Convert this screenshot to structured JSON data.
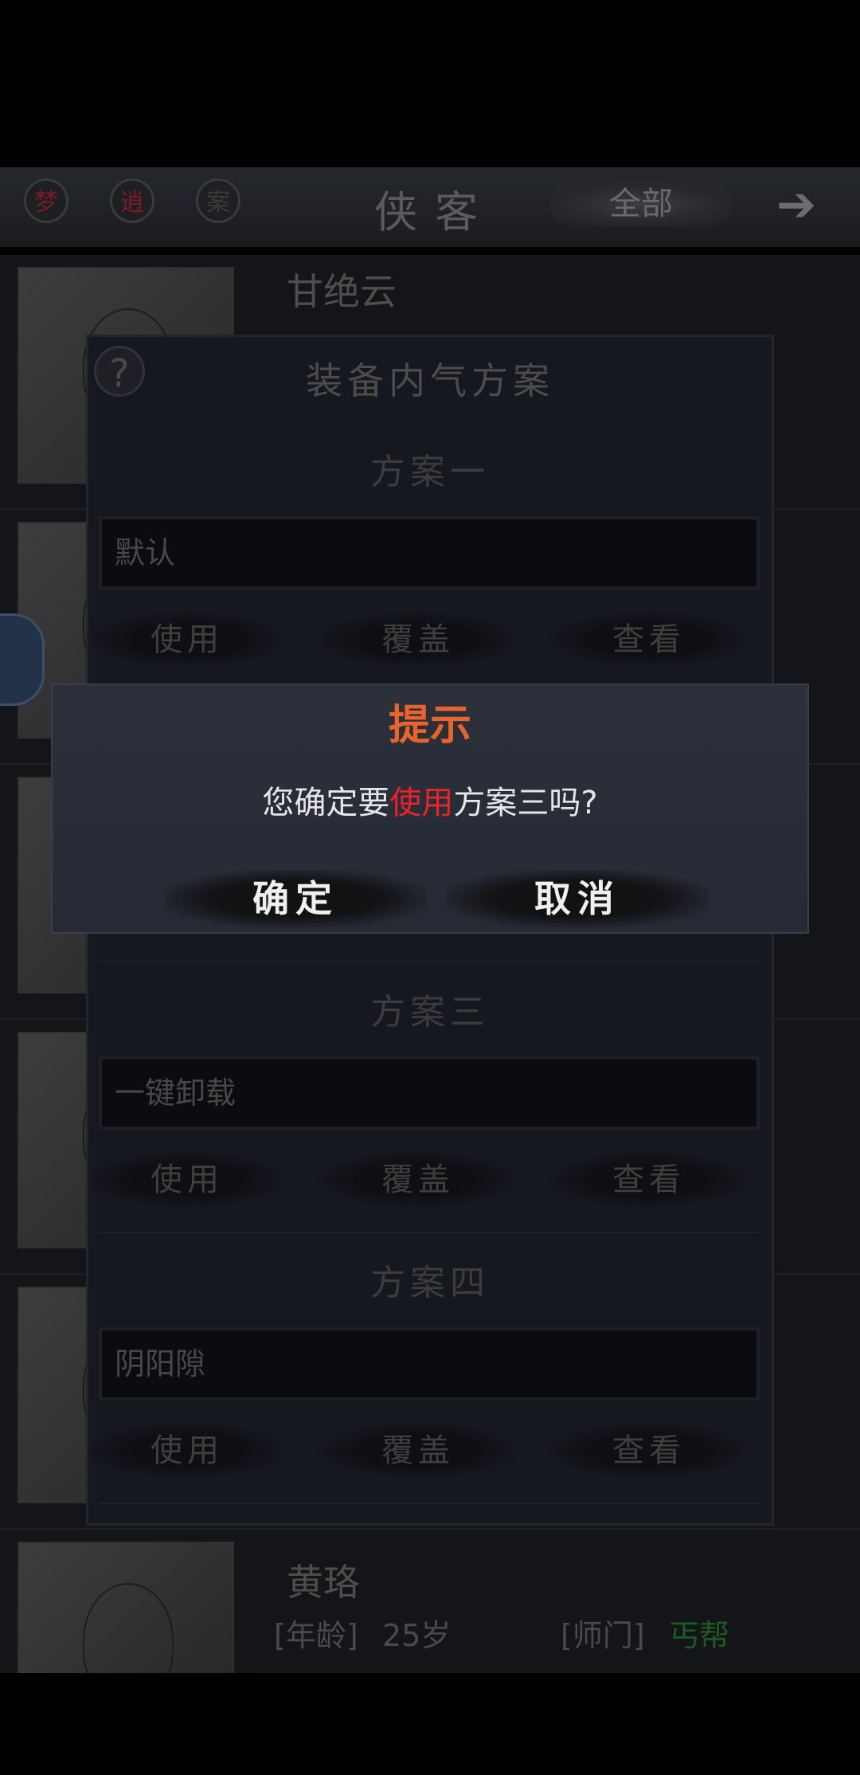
{
  "topbar": {
    "icons": [
      {
        "name": "sect-icon-1",
        "glyph": "梦"
      },
      {
        "name": "sect-icon-2",
        "glyph": "逍"
      },
      {
        "name": "sect-icon-3",
        "glyph": "案"
      }
    ],
    "title": "侠客",
    "filter": "全部",
    "next_icon": "right-arrow-icon"
  },
  "characters": [
    {
      "name": "甘绝云"
    },
    {
      "name": "黄珞"
    }
  ],
  "bottom_info": {
    "age_label": "[年龄]",
    "age_value": "25岁",
    "sect_label": "[师门]",
    "sect_value": "丐帮",
    "sect_color": "#2a7a32"
  },
  "plan_panel": {
    "help": "?",
    "title": "装备内气方案",
    "plans": [
      {
        "header": "方案一",
        "field": "默认",
        "use": "使用",
        "overwrite": "覆盖",
        "view": "查看"
      },
      {
        "header": "方案三",
        "field": "一键卸载",
        "use": "使用",
        "overwrite": "覆盖",
        "view": "查看"
      },
      {
        "header": "方案四",
        "field": "阴阳隙",
        "use": "使用",
        "overwrite": "覆盖",
        "view": "查看"
      }
    ]
  },
  "dialog": {
    "title": "提示",
    "msg_before": "您确定要",
    "msg_highlight": "使用",
    "msg_after": "方案三吗?",
    "confirm": "确定",
    "cancel": "取消",
    "title_color": "#e8642a",
    "highlight_color": "#e8242a"
  }
}
